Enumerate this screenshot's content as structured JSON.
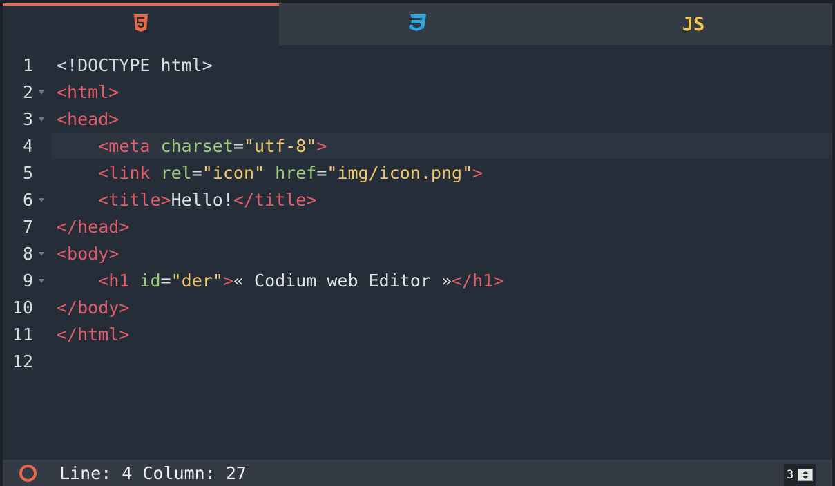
{
  "tabs": [
    {
      "id": "html",
      "icon": "html5-icon",
      "active": true,
      "color": "#e8694a"
    },
    {
      "id": "css",
      "icon": "css3-icon",
      "active": false,
      "color": "#2ea6e0"
    },
    {
      "id": "js",
      "label": "JS",
      "active": false,
      "color": "#f2c94c"
    }
  ],
  "editor": {
    "current_line": 4,
    "lines": [
      {
        "num": "1",
        "fold": false
      },
      {
        "num": "2",
        "fold": true
      },
      {
        "num": "3",
        "fold": true
      },
      {
        "num": "4",
        "fold": false
      },
      {
        "num": "5",
        "fold": false
      },
      {
        "num": "6",
        "fold": true
      },
      {
        "num": "7",
        "fold": false
      },
      {
        "num": "8",
        "fold": true
      },
      {
        "num": "9",
        "fold": true
      },
      {
        "num": "10",
        "fold": false
      },
      {
        "num": "11",
        "fold": false
      },
      {
        "num": "12",
        "fold": false
      }
    ],
    "code": {
      "l1": {
        "doctype": "<!DOCTYPE html>"
      },
      "l2": {
        "open": "<html>"
      },
      "l3": {
        "open": "<head>"
      },
      "l4": {
        "indent": "    ",
        "tag": "<meta",
        "attr": " charset",
        "eq": "=",
        "val": "\"utf-8\"",
        "close": ">"
      },
      "l5": {
        "indent": "    ",
        "tag": "<link",
        "attr1": " rel",
        "eq1": "=",
        "val1": "\"icon\"",
        "attr2": " href",
        "eq2": "=",
        "val2": "\"img/icon.png\"",
        "close": ">"
      },
      "l6": {
        "indent": "    ",
        "open": "<title>",
        "text": "Hello!",
        "close": "</title>"
      },
      "l7": {
        "close": "</head>"
      },
      "l8": {
        "open": "<body>"
      },
      "l9": {
        "indent": "    ",
        "tag": "<h1",
        "attr": " id",
        "eq": "=",
        "val": "\"der\"",
        "gt": ">",
        "text": "« Codium web Editor »",
        "close": "</h1>"
      },
      "l10": {
        "close": "</body>"
      },
      "l11": {
        "close": "</html>"
      },
      "l12": {
        "text": ""
      }
    }
  },
  "status": {
    "position_text": "Line: 4 Column: 27",
    "indicator_color": "#e8694a",
    "tab_size": "3"
  }
}
